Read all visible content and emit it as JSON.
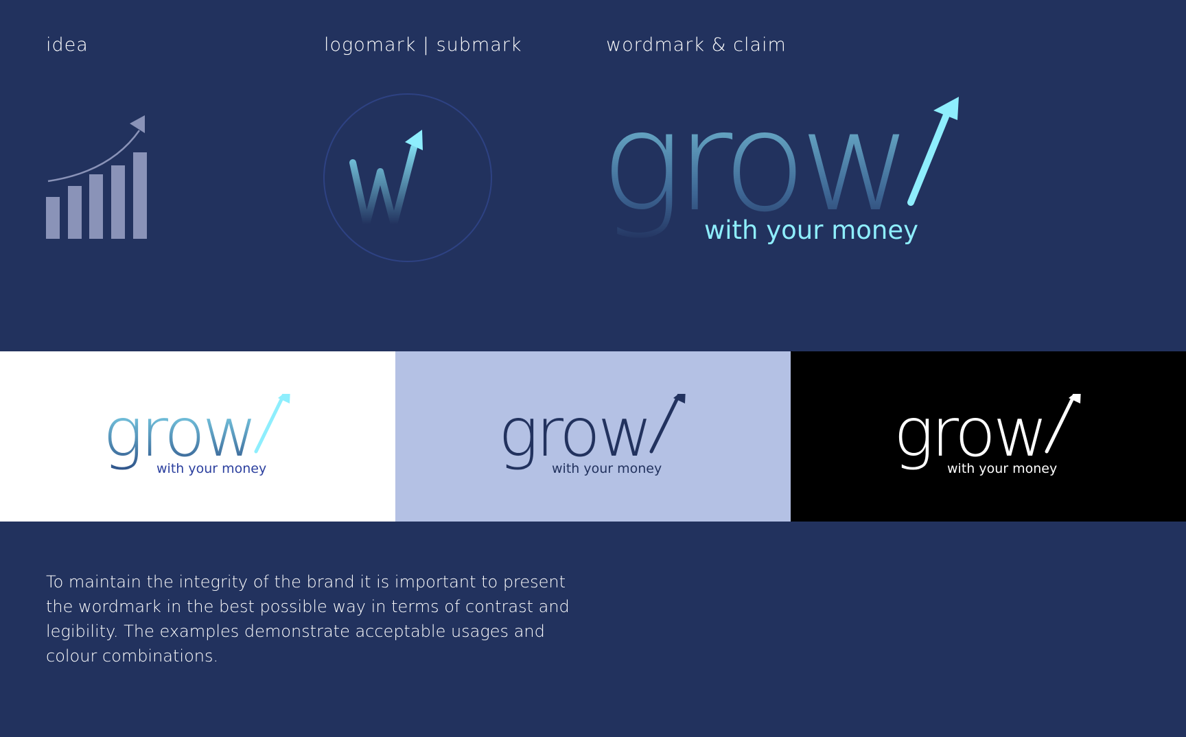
{
  "labels": {
    "idea": "idea",
    "logomark": "logomark | submark",
    "wordmark": "wordmark & claim"
  },
  "brand": {
    "wordmark": "grow",
    "claim": "with your money",
    "submark_letter": "w"
  },
  "description": "To maintain the integrity of the brand it is important to  present the wordmark in the best possible way in terms of contrast and legibility. The examples demonstrate acceptable usages and colour combinations.",
  "colors": {
    "background": "#22325e",
    "accent_cyan": "#8eeefd",
    "gradient_bottom": "#3d6593",
    "panel_white": "#ffffff",
    "panel_light": "#b4c1e4",
    "panel_black": "#000000",
    "navy_logo": "#22325e",
    "claim_blue": "#2b3f9e"
  },
  "icons": {
    "idea": "growth-bar-chart-icon",
    "submark": "w-arrow-submark-icon",
    "wordmark_arrow": "up-arrow-icon"
  }
}
